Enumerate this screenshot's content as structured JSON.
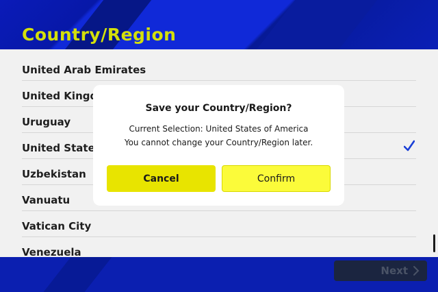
{
  "page": {
    "title": "Country/Region"
  },
  "countries": [
    {
      "name": "United Arab Emirates",
      "selected": false
    },
    {
      "name": "United Kingdom",
      "selected": false
    },
    {
      "name": "Uruguay",
      "selected": false
    },
    {
      "name": "United States of America",
      "selected": true
    },
    {
      "name": "Uzbekistan",
      "selected": false
    },
    {
      "name": "Vanuatu",
      "selected": false
    },
    {
      "name": "Vatican City",
      "selected": false
    },
    {
      "name": "Venezuela",
      "selected": false
    }
  ],
  "footer": {
    "next_label": "Next",
    "next_enabled": false
  },
  "dialog": {
    "title": "Save your Country/Region?",
    "line1": "Current Selection: United States of America",
    "line2": "You cannot change your Country/Region later.",
    "cancel_label": "Cancel",
    "confirm_label": "Confirm"
  },
  "colors": {
    "accent_yellow": "#d4e00a",
    "background_blue": "#0b1fb0",
    "check_blue": "#1a3fd6"
  },
  "icons": {
    "selected": "checkmark-icon",
    "next": "chevron-right-icon"
  }
}
